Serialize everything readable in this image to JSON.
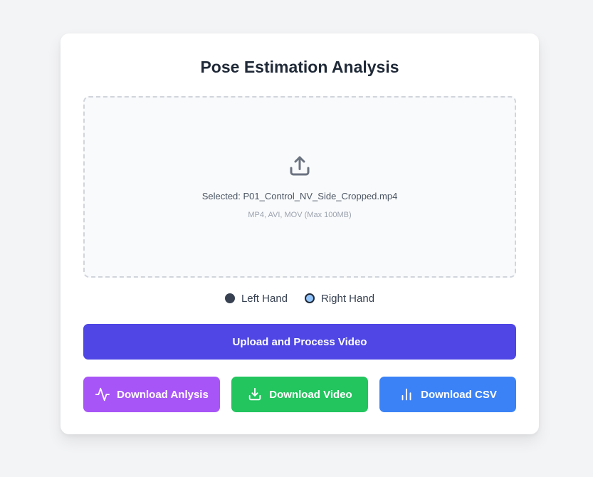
{
  "page": {
    "title": "Pose Estimation Analysis"
  },
  "upload": {
    "icon": "upload-icon",
    "selected_text": "Selected: P01_Control_NV_Side_Cropped.mp4",
    "formats_text": "MP4, AVI, MOV (Max 100MB)"
  },
  "hand_selection": {
    "options": [
      {
        "label": "Left Hand",
        "checked": false
      },
      {
        "label": "Right Hand",
        "checked": true
      }
    ]
  },
  "actions": {
    "upload_label": "Upload and Process Video",
    "downloads": [
      {
        "label": "Download Anlysis",
        "icon": "activity-icon",
        "color": "#a855f7"
      },
      {
        "label": "Download Video",
        "icon": "download-icon",
        "color": "#22c55e"
      },
      {
        "label": "Download CSV",
        "icon": "bar-chart-icon",
        "color": "#3b82f6"
      }
    ],
    "primary_color": "#4f46e5"
  }
}
